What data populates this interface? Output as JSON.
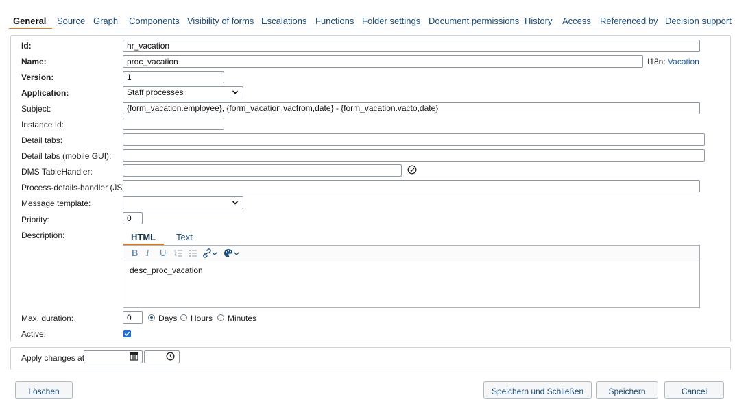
{
  "tabs": [
    "General",
    "Source",
    "Graph",
    "Components",
    "Visibility of forms",
    "Escalations",
    "Functions",
    "Folder settings",
    "Document permissions",
    "History",
    "Access",
    "Referenced by",
    "Decision support"
  ],
  "active_tab": "General",
  "form": {
    "id": {
      "label": "Id:",
      "value": "hr_vacation"
    },
    "name": {
      "label": "Name:",
      "value": "proc_vacation",
      "i18n_prefix": "I18n:",
      "i18n_value": "Vacation"
    },
    "version": {
      "label": "Version:",
      "value": "1"
    },
    "application": {
      "label": "Application:",
      "value": "Staff processes"
    },
    "subject": {
      "label": "Subject:",
      "value": "{form_vacation.employee}, {form_vacation.vacfrom,date} - {form_vacation.vacto,date}"
    },
    "instance_id": {
      "label": "Instance Id:",
      "value": ""
    },
    "detail_tabs": {
      "label": "Detail tabs:",
      "value": ""
    },
    "detail_tabs_mobile": {
      "label": "Detail tabs (mobile GUI):",
      "value": ""
    },
    "dms_table_handler": {
      "label": "DMS TableHandler:",
      "value": ""
    },
    "process_details_handler": {
      "label": "Process-details-handler (JS):",
      "value": ""
    },
    "message_template": {
      "label": "Message template:",
      "value": ""
    },
    "priority": {
      "label": "Priority:",
      "value": "0"
    },
    "description": {
      "label": "Description:",
      "tabs": [
        "HTML",
        "Text"
      ],
      "active_tab": "HTML",
      "toolbar": [
        "bold-icon",
        "italic-icon",
        "underline-icon",
        "ordered-list-icon",
        "bullet-list-icon",
        "link-icon",
        "color-palette-icon"
      ],
      "content": "desc_proc_vacation"
    },
    "max_duration": {
      "label": "Max. duration:",
      "value": "0",
      "options": [
        "Days",
        "Hours",
        "Minutes"
      ],
      "selected": "Days"
    },
    "active": {
      "label": "Active:",
      "checked": true
    }
  },
  "apply": {
    "label": "Apply changes at:",
    "date_value": "",
    "time_value": ""
  },
  "buttons": {
    "delete": "Löschen",
    "save_close": "Speichern und Schließen",
    "save": "Speichern",
    "cancel": "Cancel"
  },
  "colors": {
    "accent": "#e07a1f",
    "link": "#1d4d7a",
    "checkbox": "#1f6fd1"
  }
}
